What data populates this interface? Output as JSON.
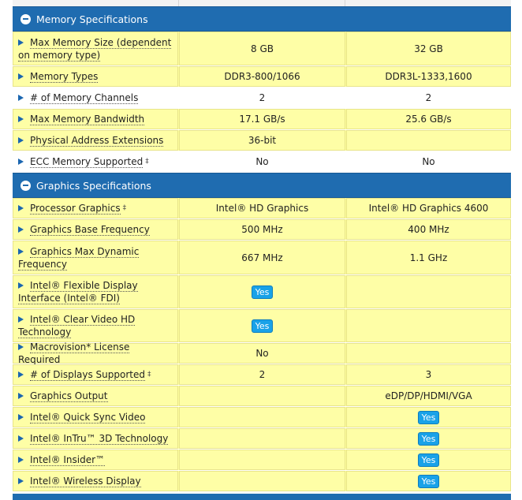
{
  "sections": [
    {
      "title": "Memory Specifications",
      "rows": [
        {
          "label": "Max Memory Size (dependent on memory type)",
          "v1": "8 GB",
          "v2": "32 GB",
          "bg": "yellow",
          "h": 44
        },
        {
          "label": "Memory Types",
          "v1": "DDR3-800/1066",
          "v2": "DDR3L-1333,1600",
          "bg": "yellow",
          "h": 27
        },
        {
          "label": "# of Memory Channels",
          "v1": "2",
          "v2": "2",
          "bg": "white",
          "h": 27
        },
        {
          "label": "Max Memory Bandwidth",
          "v1": "17.1 GB/s",
          "v2": "25.6 GB/s",
          "bg": "yellow",
          "h": 27
        },
        {
          "label": "Physical Address Extensions",
          "v1": "36-bit",
          "v2": "",
          "bg": "yellow",
          "h": 27
        },
        {
          "label": "ECC Memory Supported",
          "v1": "No",
          "v2": "No",
          "bg": "white",
          "h": 27,
          "mark": "‡"
        }
      ]
    },
    {
      "title": "Graphics Specifications",
      "rows": [
        {
          "label": "Processor Graphics",
          "v1": "Intel® HD Graphics",
          "v2": "Intel® HD Graphics 4600",
          "bg": "yellow",
          "h": 27,
          "mark": "‡"
        },
        {
          "label": "Graphics Base Frequency",
          "v1": "500 MHz",
          "v2": "400 MHz",
          "bg": "yellow",
          "h": 27
        },
        {
          "label": "Graphics Max Dynamic Frequency",
          "v1": "667 MHz",
          "v2": "1.1 GHz",
          "bg": "yellow",
          "h": 44
        },
        {
          "label": "Intel® Flexible Display Interface (Intel® FDI)",
          "v1": "Yes",
          "v2": "",
          "bg": "yellow",
          "h": 43,
          "badge1": true
        },
        {
          "label": "Intel® Clear Video HD Technology",
          "v1": "Yes",
          "v2": "",
          "bg": "yellow",
          "h": 43,
          "badge1": true
        },
        {
          "label": "Macrovision* License Required",
          "v1": "No",
          "v2": "",
          "bg": "yellow",
          "h": 27
        },
        {
          "label": "# of Displays Supported",
          "v1": "2",
          "v2": "3",
          "bg": "yellow",
          "h": 27,
          "mark": "‡"
        },
        {
          "label": "Graphics Output",
          "v1": "",
          "v2": "eDP/DP/HDMI/VGA",
          "bg": "yellow",
          "h": 27
        },
        {
          "label": "Intel® Quick Sync Video",
          "v1": "",
          "v2": "Yes",
          "bg": "yellow",
          "h": 27,
          "badge2": true
        },
        {
          "label": "Intel® InTru™ 3D Technology",
          "v1": "",
          "v2": "Yes",
          "bg": "yellow",
          "h": 27,
          "badge2": true
        },
        {
          "label": "Intel® Insider™",
          "v1": "",
          "v2": "Yes",
          "bg": "yellow",
          "h": 27,
          "badge2": true
        },
        {
          "label": "Intel® Wireless Display",
          "v1": "",
          "v2": "Yes",
          "bg": "yellow",
          "h": 27,
          "badge2": true
        }
      ]
    }
  ],
  "colors": {
    "header_blue": "#1f6cb0",
    "row_yellow": "#fefea6",
    "yes_badge": "#19a2e8",
    "arrow_blue": "#1a66b0"
  },
  "icons": {
    "collapse": "collapse-minus-icon",
    "expand_row": "triangle-right-icon"
  }
}
